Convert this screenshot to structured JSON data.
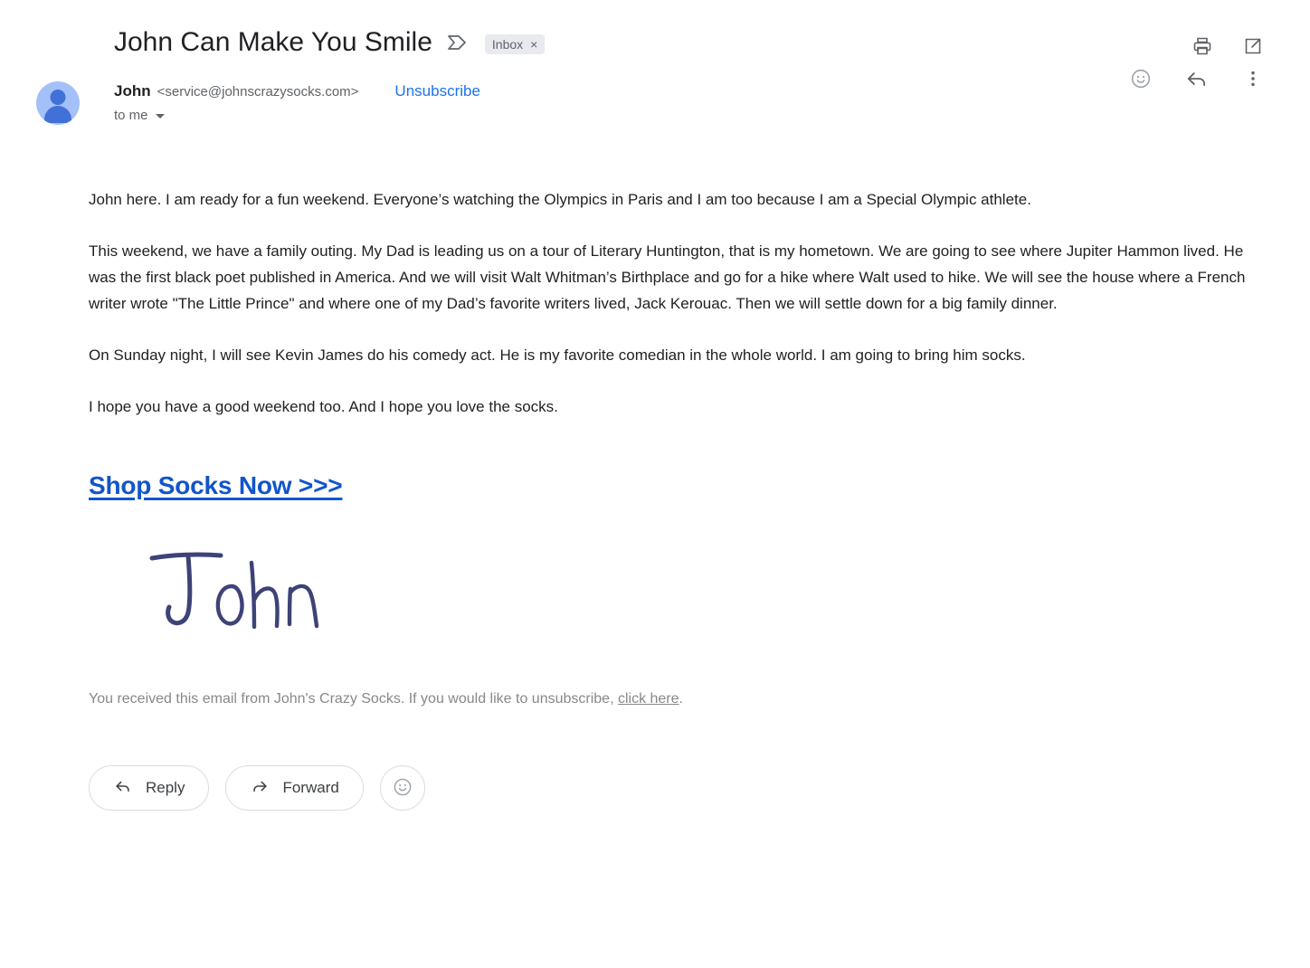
{
  "header": {
    "subject": "John Can Make You Smile",
    "important_icon": "important-marker-icon",
    "label_chip": {
      "text": "Inbox",
      "remove": "×"
    },
    "actions": [
      {
        "name": "print-icon",
        "label": "Print"
      },
      {
        "name": "open-in-new-icon",
        "label": "Open in new window"
      }
    ]
  },
  "sender": {
    "avatar_alt": "John",
    "name": "John",
    "email": "<service@johnscrazysocks.com>",
    "unsubscribe_label": "Unsubscribe",
    "recipient": "to me",
    "actions": [
      {
        "name": "add-reaction-icon",
        "label": "Add emoji reaction"
      },
      {
        "name": "reply-icon",
        "label": "Reply"
      },
      {
        "name": "more-options-icon",
        "label": "More"
      }
    ]
  },
  "body": {
    "paragraphs": [
      "John here. I am ready for a fun weekend. Everyone’s watching the Olympics in Paris and I am too because I am a Special Olympic athlete.",
      "This weekend, we have a family outing. My Dad is leading us on a tour of Literary Huntington, that is my hometown. We are going to see where Jupiter Hammon lived. He was the first black poet published in America. And we will visit Walt Whitman’s Birthplace and go for a hike where Walt used to hike.  We will see the house where a French writer wrote \"The Little Prince\" and where one of my Dad’s favorite writers lived, Jack Kerouac. Then we will settle down for a big family dinner.",
      "On Sunday night, I will see Kevin James do his comedy act. He is my favorite comedian in the whole world. I am going to bring him socks.",
      "I hope you have a good weekend too. And I hope you love the socks."
    ],
    "cta_label": "Shop Socks Now >>>",
    "signature_alt": "John",
    "footer_before": "You received this email from John's Crazy Socks. If you would like to unsubscribe, ",
    "footer_link": "click here",
    "footer_after": "."
  },
  "action_bar": {
    "reply_label": "Reply",
    "forward_label": "Forward",
    "react_icon": "add-reaction-icon"
  },
  "colors": {
    "link_blue": "#1a73e8",
    "cta_blue": "#1155cc",
    "icon_gray": "#5f6368",
    "chip_bg": "#e8eaed",
    "signature_ink": "#3d4377"
  }
}
